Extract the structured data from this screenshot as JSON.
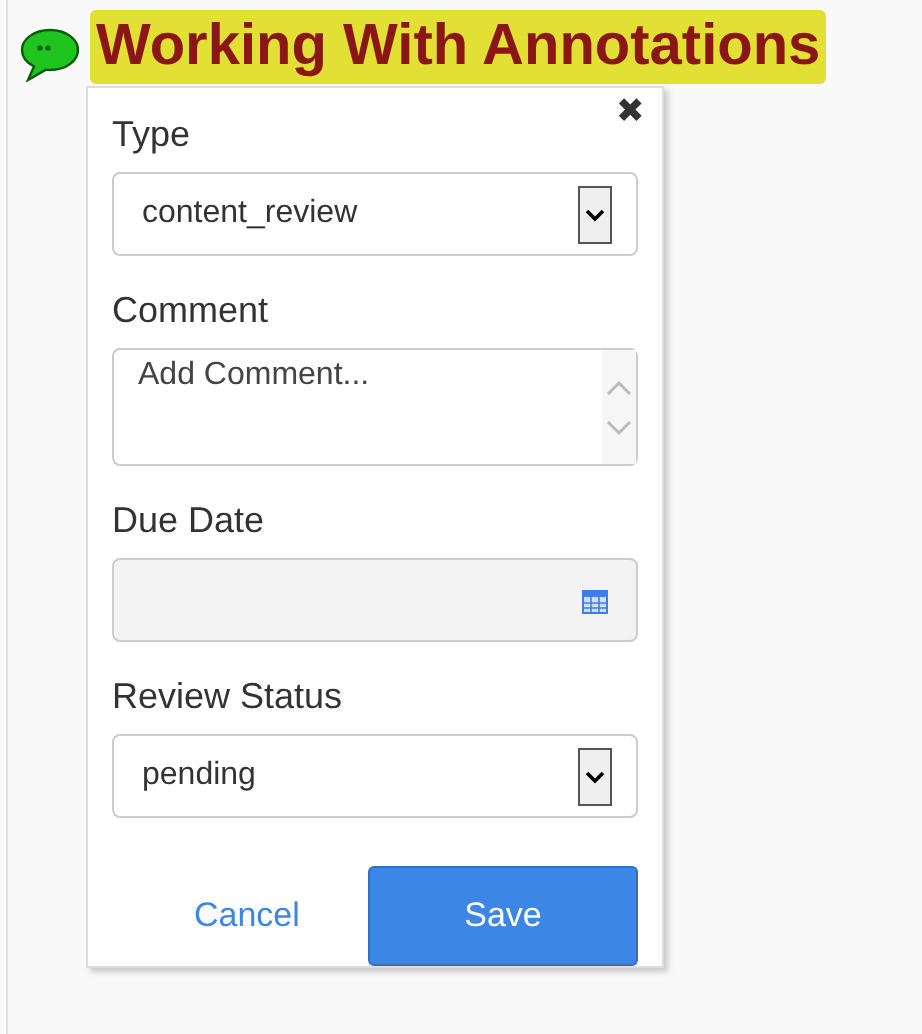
{
  "heading": {
    "title": "Working With Annotations"
  },
  "dialog": {
    "close": "✖",
    "fields": [
      {
        "kind": "select",
        "label": "Type",
        "value": "content_review",
        "disabled": false
      },
      {
        "kind": "textarea",
        "label": "Comment",
        "placeholder": "Add Comment...",
        "disabled": false
      },
      {
        "kind": "date",
        "label": "Due Date",
        "disabled": true
      },
      {
        "kind": "select",
        "label": "Review Status",
        "value": "pending",
        "disabled": false
      }
    ],
    "buttons": [
      {
        "kind": "link",
        "label": "Cancel"
      },
      {
        "kind": "primary",
        "label": "Save"
      }
    ]
  }
}
